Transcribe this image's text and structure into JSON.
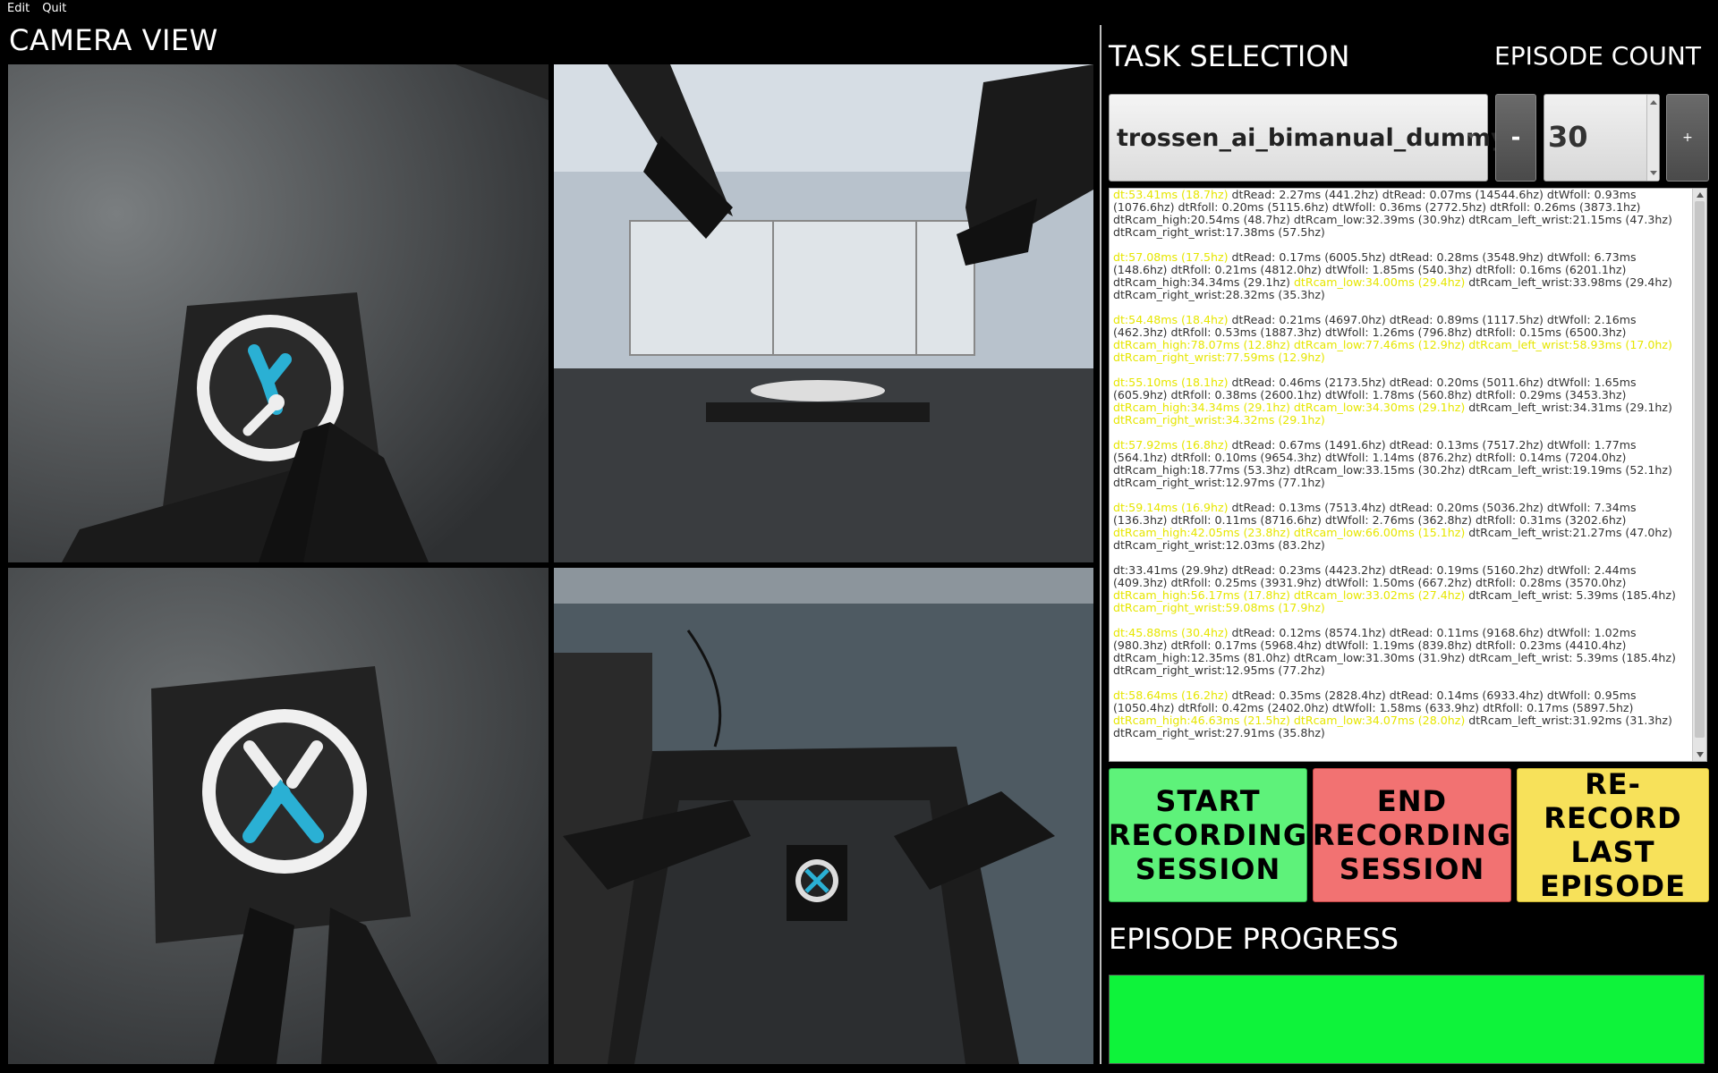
{
  "menu": {
    "edit": "Edit",
    "quit": "Quit"
  },
  "camera": {
    "title": "CAMERA VIEW"
  },
  "task": {
    "title": "TASK SELECTION",
    "selected": "trossen_ai_bimanual_dummy"
  },
  "episode": {
    "title": "EPISODE COUNT",
    "minus_label": "-",
    "count": "30",
    "plus_label": "+"
  },
  "log": {
    "entries": [
      {
        "dt": "dt:53.41ms (18.7hz)",
        "body": [
          [
            "n",
            "dtRead: 2.27ms (441.2hz) dtRead: 0.07ms (14544.6hz) dtWfoll: 0.93ms (1076.6hz) dtRfoll: 0.20ms (5115.6hz) dtWfoll: 0.36ms (2772.5hz) dtRfoll: 0.26ms (3873.1hz) dtRcam_high:20.54ms (48.7hz) dtRcam_low:32.39ms (30.9hz) dtRcam_left_wrist:21.15ms (47.3hz) dtRcam_right_wrist:17.38ms (57.5hz)"
          ]
        ]
      },
      {
        "dt": "dt:57.08ms (17.5hz)",
        "body": [
          [
            "n",
            "dtRead: 0.17ms (6005.5hz) dtRead: 0.28ms (3548.9hz) dtWfoll: 6.73ms (148.6hz) dtRfoll: 0.21ms (4812.0hz) dtWfoll: 1.85ms (540.3hz) dtRfoll: 0.16ms (6201.1hz) dtRcam_high:34.34ms (29.1hz) "
          ],
          [
            "y",
            "dtRcam_low:34.00ms (29.4hz)"
          ],
          [
            "n",
            " dtRcam_left_wrist:33.98ms (29.4hz) dtRcam_right_wrist:28.32ms (35.3hz)"
          ]
        ]
      },
      {
        "dt": "dt:54.48ms (18.4hz)",
        "body": [
          [
            "n",
            "dtRead: 0.21ms (4697.0hz) dtRead: 0.89ms (1117.5hz) dtWfoll: 2.16ms (462.3hz) dtRfoll: 0.53ms (1887.3hz) dtWfoll: 1.26ms (796.8hz) dtRfoll: 0.15ms (6500.3hz) "
          ],
          [
            "y",
            "dtRcam_high:78.07ms (12.8hz) dtRcam_low:77.46ms (12.9hz) dtRcam_left_wrist:58.93ms (17.0hz) dtRcam_right_wrist:77.59ms (12.9hz)"
          ]
        ]
      },
      {
        "dt": "dt:55.10ms (18.1hz)",
        "body": [
          [
            "n",
            "dtRead: 0.46ms (2173.5hz) dtRead: 0.20ms (5011.6hz) dtWfoll: 1.65ms (605.9hz) dtRfoll: 0.38ms (2600.1hz) dtWfoll: 1.78ms (560.8hz) dtRfoll: 0.29ms (3453.3hz) "
          ],
          [
            "y",
            "dtRcam_high:34.34ms (29.1hz) dtRcam_low:34.30ms (29.1hz)"
          ],
          [
            "n",
            " dtRcam_left_wrist:34.31ms (29.1hz) "
          ],
          [
            "y",
            "dtRcam_right_wrist:34.32ms (29.1hz)"
          ]
        ]
      },
      {
        "dt": "dt:57.92ms (16.8hz)",
        "body": [
          [
            "n",
            "dtRead: 0.67ms (1491.6hz) dtRead: 0.13ms (7517.2hz) dtWfoll: 1.77ms (564.1hz) dtRfoll: 0.10ms (9654.3hz) dtWfoll: 1.14ms (876.2hz) dtRfoll: 0.14ms (7204.0hz) dtRcam_high:18.77ms (53.3hz) dtRcam_low:33.15ms (30.2hz) dtRcam_left_wrist:19.19ms (52.1hz) dtRcam_right_wrist:12.97ms (77.1hz)"
          ]
        ]
      },
      {
        "dt": "dt:59.14ms (16.9hz)",
        "body": [
          [
            "n",
            "dtRead: 0.13ms (7513.4hz) dtRead: 0.20ms (5036.2hz) dtWfoll: 7.34ms (136.3hz) dtRfoll: 0.11ms (8716.6hz) dtWfoll: 2.76ms (362.8hz) dtRfoll: 0.31ms (3202.6hz) "
          ],
          [
            "y",
            "dtRcam_high:42.05ms (23.8hz) dtRcam_low:66.00ms (15.1hz)"
          ],
          [
            "n",
            " dtRcam_left_wrist:21.27ms (47.0hz) dtRcam_right_wrist:12.03ms (83.2hz)"
          ]
        ]
      },
      {
        "dt": "",
        "body": [
          [
            "n",
            "dt:33.41ms (29.9hz) dtRead: 0.23ms (4423.2hz) dtRead: 0.19ms (5160.2hz) dtWfoll: 2.44ms (409.3hz) dtRfoll: 0.25ms (3931.9hz) dtWfoll: 1.50ms (667.2hz) dtRfoll: 0.28ms (3570.0hz) "
          ],
          [
            "y",
            "dtRcam_high:56.17ms (17.8hz) dtRcam_low:33.02ms (27.4hz)"
          ],
          [
            "n",
            " dtRcam_left_wrist: 5.39ms (185.4hz) "
          ],
          [
            "y",
            "dtRcam_right_wrist:59.08ms (17.9hz)"
          ]
        ]
      },
      {
        "dt": "dt:45.88ms (30.4hz)",
        "body": [
          [
            "n",
            "dtRead: 0.12ms (8574.1hz) dtRead: 0.11ms (9168.6hz) dtWfoll: 1.02ms (980.3hz) dtRfoll: 0.17ms (5968.4hz) dtWfoll: 1.19ms (839.8hz) dtRfoll: 0.23ms (4410.4hz) dtRcam_high:12.35ms (81.0hz) dtRcam_low:31.30ms (31.9hz) dtRcam_left_wrist: 5.39ms (185.4hz) dtRcam_right_wrist:12.95ms (77.2hz)"
          ]
        ]
      },
      {
        "dt": "dt:58.64ms (16.2hz)",
        "body": [
          [
            "n",
            "dtRead: 0.35ms (2828.4hz) dtRead: 0.14ms (6933.4hz) dtWfoll: 0.95ms (1050.4hz) dtRfoll: 0.42ms (2402.0hz) dtWfoll: 1.58ms (633.9hz) dtRfoll: 0.17ms (5897.5hz) "
          ],
          [
            "y",
            "dtRcam_high:46.63ms (21.5hz) dtRcam_low:34.07ms (28.0hz)"
          ],
          [
            "n",
            " dtRcam_left_wrist:31.92ms (31.3hz) dtRcam_right_wrist:27.91ms (35.8hz)"
          ]
        ]
      }
    ]
  },
  "buttons": {
    "start": "START RECORDING SESSION",
    "end": "END RECORDING SESSION",
    "rerecord": "RE-RECORD LAST EPISODE"
  },
  "progress": {
    "title": "EPISODE PROGRESS",
    "fraction": 1.0
  },
  "colors": {
    "start": "#5ef27a",
    "end": "#f27272",
    "rerecord": "#f7e15a",
    "progress": "#0ef33a",
    "log_highlight": "#e6e600"
  }
}
